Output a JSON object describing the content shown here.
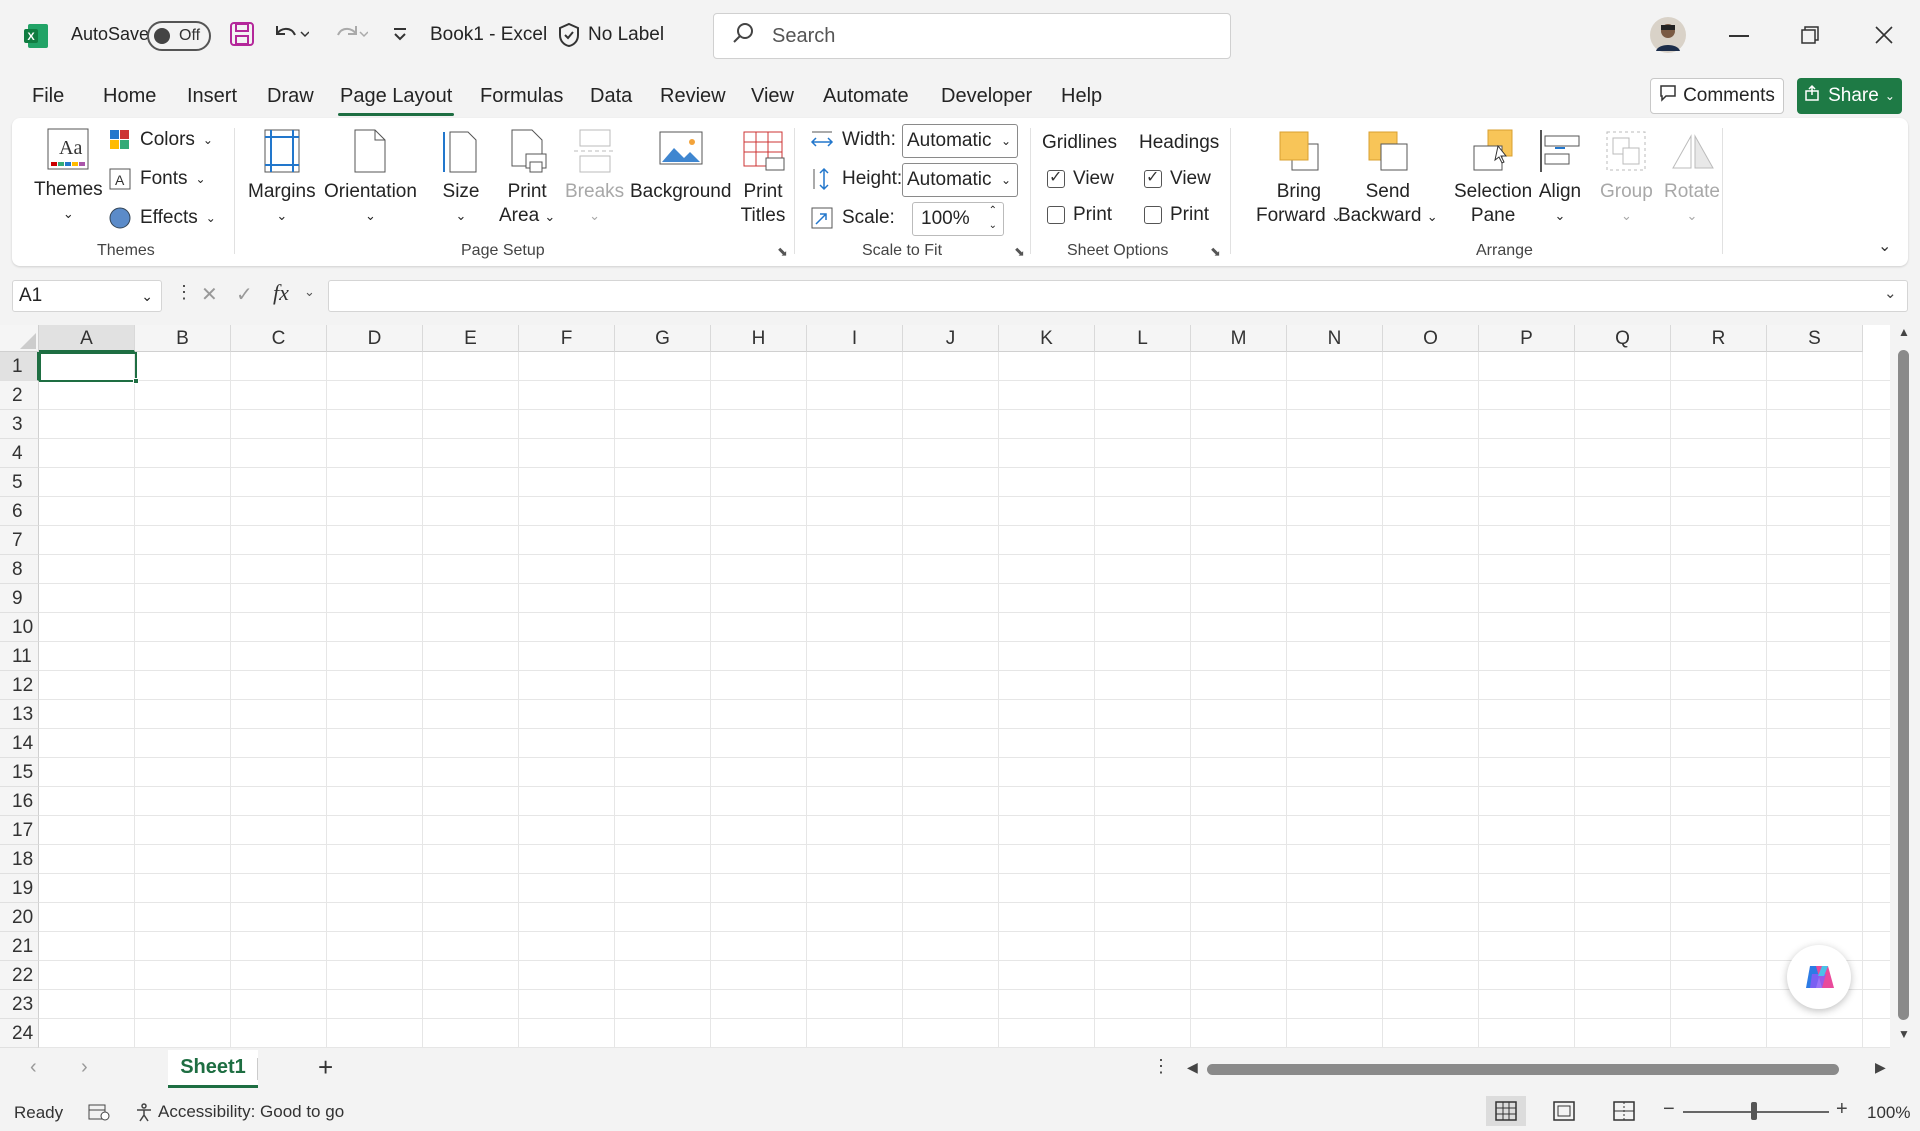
{
  "titlebar": {
    "autosave_label": "AutoSave",
    "autosave_state": "Off",
    "doc_title": "Book1  -  Excel",
    "label_text": "No Label",
    "search_placeholder": "Search"
  },
  "menu": [
    "File",
    "Home",
    "Insert",
    "Draw",
    "Page Layout",
    "Formulas",
    "Data",
    "Review",
    "View",
    "Automate",
    "Developer",
    "Help"
  ],
  "active_menu": "Page Layout",
  "actions": {
    "comments": "Comments",
    "share": "Share"
  },
  "ribbon": {
    "themes": {
      "themes_label": "Themes",
      "colors": "Colors",
      "fonts": "Fonts",
      "effects": "Effects",
      "group": "Themes"
    },
    "page_setup": {
      "margins": "Margins",
      "orientation": "Orientation",
      "size": "Size",
      "print_area_1": "Print",
      "print_area_2": "Area",
      "breaks": "Breaks",
      "background": "Background",
      "print_titles_1": "Print",
      "print_titles_2": "Titles",
      "group": "Page Setup"
    },
    "scale": {
      "width_label": "Width:",
      "width_value": "Automatic",
      "height_label": "Height:",
      "height_value": "Automatic",
      "scale_label": "Scale:",
      "scale_value": "100%",
      "group": "Scale to Fit"
    },
    "sheet_options": {
      "gridlines": "Gridlines",
      "headings": "Headings",
      "view": "View",
      "print": "Print",
      "group": "Sheet Options"
    },
    "arrange": {
      "bring_1": "Bring",
      "bring_2": "Forward",
      "send_1": "Send",
      "send_2": "Backward",
      "sel_1": "Selection",
      "sel_2": "Pane",
      "align": "Align",
      "group_btn": "Group",
      "rotate": "Rotate",
      "group": "Arrange"
    }
  },
  "formula_bar": {
    "name_box": "A1",
    "fx": "fx"
  },
  "columns": [
    "A",
    "B",
    "C",
    "D",
    "E",
    "F",
    "G",
    "H",
    "I",
    "J",
    "K",
    "L",
    "M",
    "N",
    "O",
    "P",
    "Q",
    "R",
    "S"
  ],
  "rows": [
    "1",
    "2",
    "3",
    "4",
    "5",
    "6",
    "7",
    "8",
    "9",
    "10",
    "11",
    "12",
    "13",
    "14",
    "15",
    "16",
    "17",
    "18",
    "19",
    "20",
    "21",
    "22",
    "23",
    "24"
  ],
  "sheet_tab": "Sheet1",
  "status": {
    "ready": "Ready",
    "accessibility": "Accessibility: Good to go",
    "zoom": "100%"
  },
  "colors": {
    "accent": "#1e6e42",
    "share_bg": "#1e7a45",
    "excel_green": "#107c41"
  }
}
